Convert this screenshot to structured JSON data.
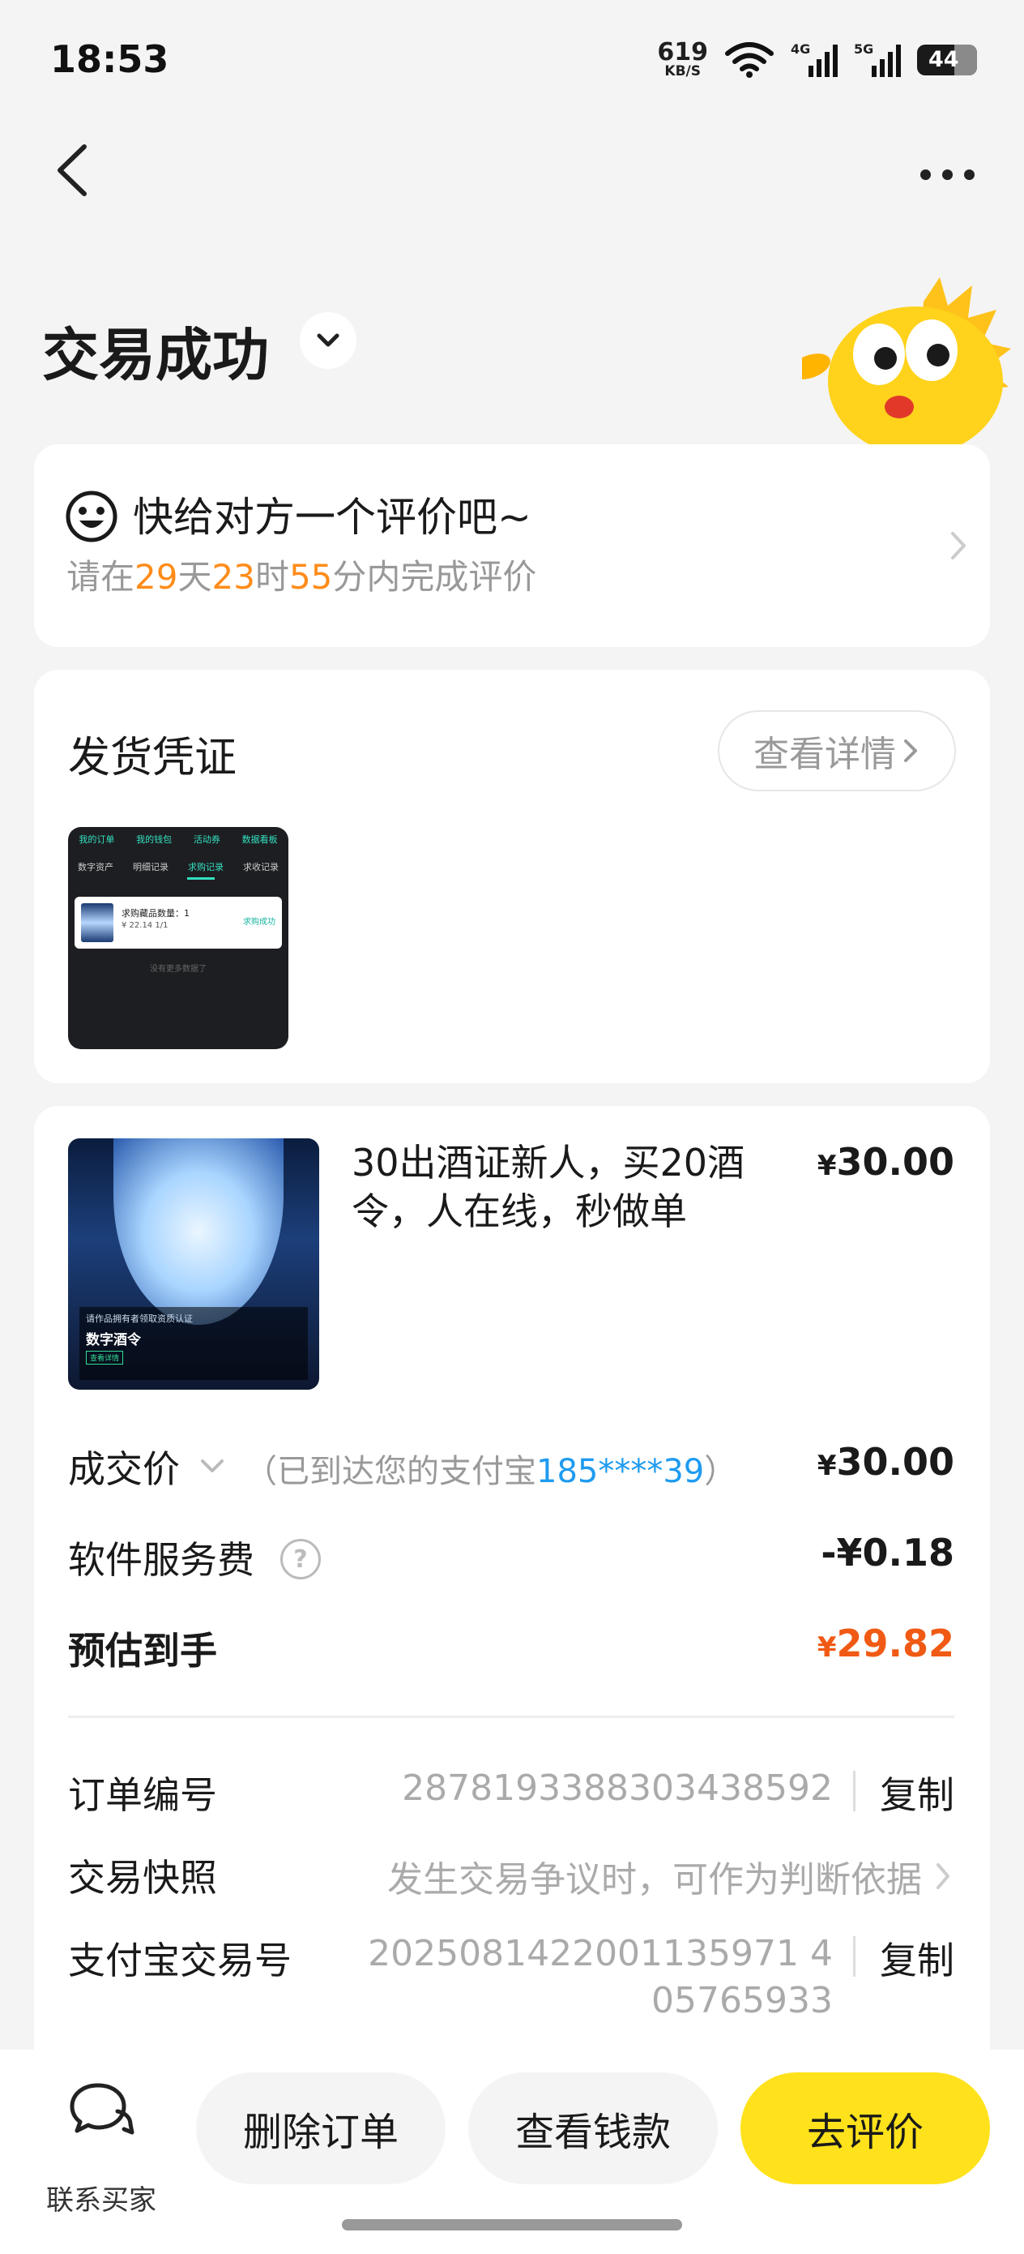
{
  "status_bar": {
    "time": "18:53",
    "net_speed": "619",
    "net_unit": "KB/S",
    "net_4g": "4G",
    "net_5g": "5G",
    "battery": "44"
  },
  "header": {
    "title": "交易成功"
  },
  "review_prompt": {
    "title": "快给对方一个评价吧~",
    "sub_prefix": "请在",
    "days": "29",
    "days_unit": "天",
    "hours": "23",
    "hours_unit": "时",
    "minutes": "55",
    "sub_suffix": "分内完成评价"
  },
  "delivery_proof": {
    "title": "发货凭证",
    "view_details": "查看详情",
    "thumbnail": {
      "tabs_top": [
        "我的订单",
        "我的钱包",
        "活动券",
        "数据看板"
      ],
      "tabs_second": [
        "数字资产",
        "明细记录",
        "求购记录",
        "求收记录"
      ],
      "item_line1": "求购藏品数量：1",
      "item_line2": "¥ 22.14 1/1",
      "item_status": "求购成功",
      "footer": "没有更多数据了"
    }
  },
  "order": {
    "product_title": "30出酒证新人，买20酒令，人在线，秒做单",
    "product_price": "30.00",
    "product_image_text": "数字酒令",
    "product_image_caption": "请作品拥有者领取资质认证",
    "product_image_tag": "查看详情",
    "currency": "¥",
    "deal_label": "成交价",
    "deal_note_prefix": "（已到达您的支付宝",
    "deal_account": "185****39",
    "deal_note_suffix": "）",
    "deal_value": "30.00",
    "fee_label": "软件服务费",
    "fee_help": "?",
    "fee_value": "-¥0.18",
    "estimate_label": "预估到手",
    "estimate_value": "29.82",
    "order_no_label": "订单编号",
    "order_no": "2878193388303438592",
    "copy": "复制",
    "snapshot_label": "交易快照",
    "snapshot_value": "发生交易争议时，可作为判断依据",
    "alipay_label": "支付宝交易号",
    "alipay_no_line1": "2025081422001135971 4",
    "alipay_no_line2": "05765933"
  },
  "bottom_bar": {
    "contact": "联系买家",
    "delete": "删除订单",
    "view_money": "查看钱款",
    "review": "去评价"
  },
  "colors": {
    "accent_yellow": "#ffe21b",
    "highlight_orange": "#ff8c1a",
    "estimate_red": "#f05a14",
    "link_blue": "#1e9bf0"
  }
}
